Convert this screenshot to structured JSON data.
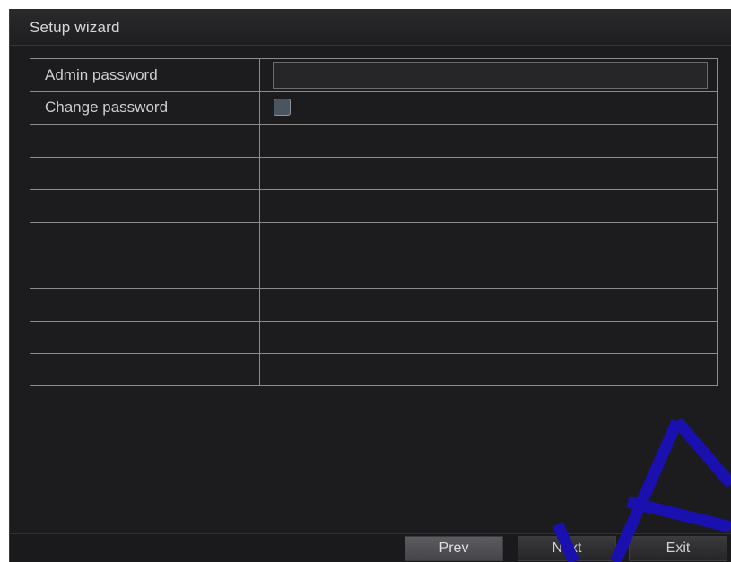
{
  "window": {
    "title": "Setup wizard"
  },
  "form": {
    "rows": [
      {
        "label": "Admin password",
        "control": "password",
        "value": ""
      },
      {
        "label": "Change password",
        "control": "checkbox",
        "checked": false
      },
      {
        "label": ""
      },
      {
        "label": ""
      },
      {
        "label": ""
      },
      {
        "label": ""
      },
      {
        "label": ""
      },
      {
        "label": ""
      },
      {
        "label": ""
      },
      {
        "label": ""
      }
    ]
  },
  "footer": {
    "prev_label": "Prev",
    "next_label": "Next",
    "exit_label": "Exit"
  },
  "colors": {
    "background": "#1c1c1e",
    "grid_line": "#8c8c8c",
    "watermark": "#1a10b0"
  }
}
